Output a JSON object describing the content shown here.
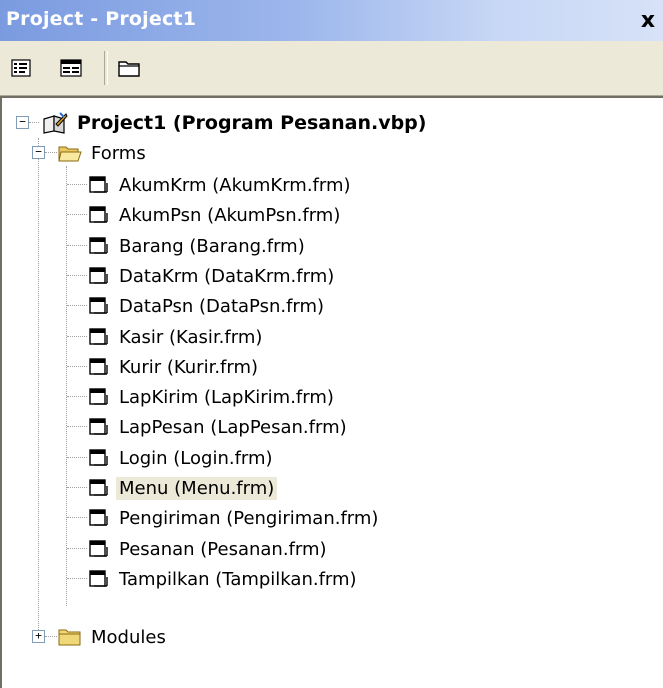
{
  "window": {
    "title": "Project - Project1",
    "close_glyph": "x"
  },
  "toolbar": {
    "buttons": [
      {
        "icon": "view-code-icon"
      },
      {
        "icon": "view-object-icon"
      },
      {
        "icon": "toggle-folders-icon"
      }
    ]
  },
  "tree": {
    "root": {
      "label": "Project1 (Program Pesanan.vbp)",
      "expander": "−",
      "icon": "project-icon"
    },
    "forms_folder": {
      "label": "Forms",
      "expander": "−",
      "icon": "open-folder-icon"
    },
    "forms": [
      {
        "label": "AkumKrm (AkumKrm.frm)"
      },
      {
        "label": "AkumPsn (AkumPsn.frm)"
      },
      {
        "label": "Barang (Barang.frm)"
      },
      {
        "label": "DataKrm (DataKrm.frm)"
      },
      {
        "label": "DataPsn (DataPsn.frm)"
      },
      {
        "label": "Kasir (Kasir.frm)"
      },
      {
        "label": "Kurir (Kurir.frm)"
      },
      {
        "label": "LapKirim (LapKirim.frm)"
      },
      {
        "label": "LapPesan (LapPesan.frm)"
      },
      {
        "label": "Login (Login.frm)"
      },
      {
        "label": "Menu (Menu.frm)",
        "selected": true
      },
      {
        "label": "Pengiriman (Pengiriman.frm)"
      },
      {
        "label": "Pesanan (Pesanan.frm)"
      },
      {
        "label": "Tampilkan (Tampilkan.frm)"
      }
    ],
    "modules_folder": {
      "label": "Modules",
      "expander": "+",
      "icon": "closed-folder-icon"
    }
  },
  "colors": {
    "title_gradient_start": "#7b9be0",
    "title_gradient_end": "#d7e2f8",
    "toolbar_bg": "#ece9d8",
    "selected_bg": "#ece9d8"
  }
}
